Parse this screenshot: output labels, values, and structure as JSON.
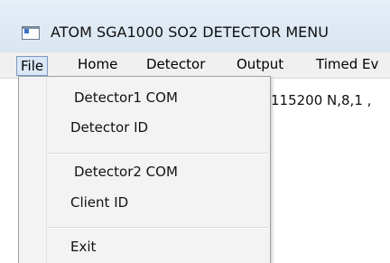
{
  "window": {
    "title": "ATOM SGA1000 SO2 DETECTOR MENU",
    "icon": "app-window-icon"
  },
  "menubar": {
    "items": [
      {
        "label": "File",
        "active": true
      },
      {
        "label": "Home"
      },
      {
        "label": "Detector"
      },
      {
        "label": "Output"
      },
      {
        "label": "Timed Ev"
      }
    ]
  },
  "file_menu": {
    "items": [
      {
        "label": "Detector1 COM"
      },
      {
        "label": "Detector ID"
      },
      {
        "label": "Detector2 COM"
      },
      {
        "label": "Client ID"
      },
      {
        "label": "Exit"
      }
    ]
  },
  "background": {
    "status_text": "115200  N,8,1 ,"
  }
}
